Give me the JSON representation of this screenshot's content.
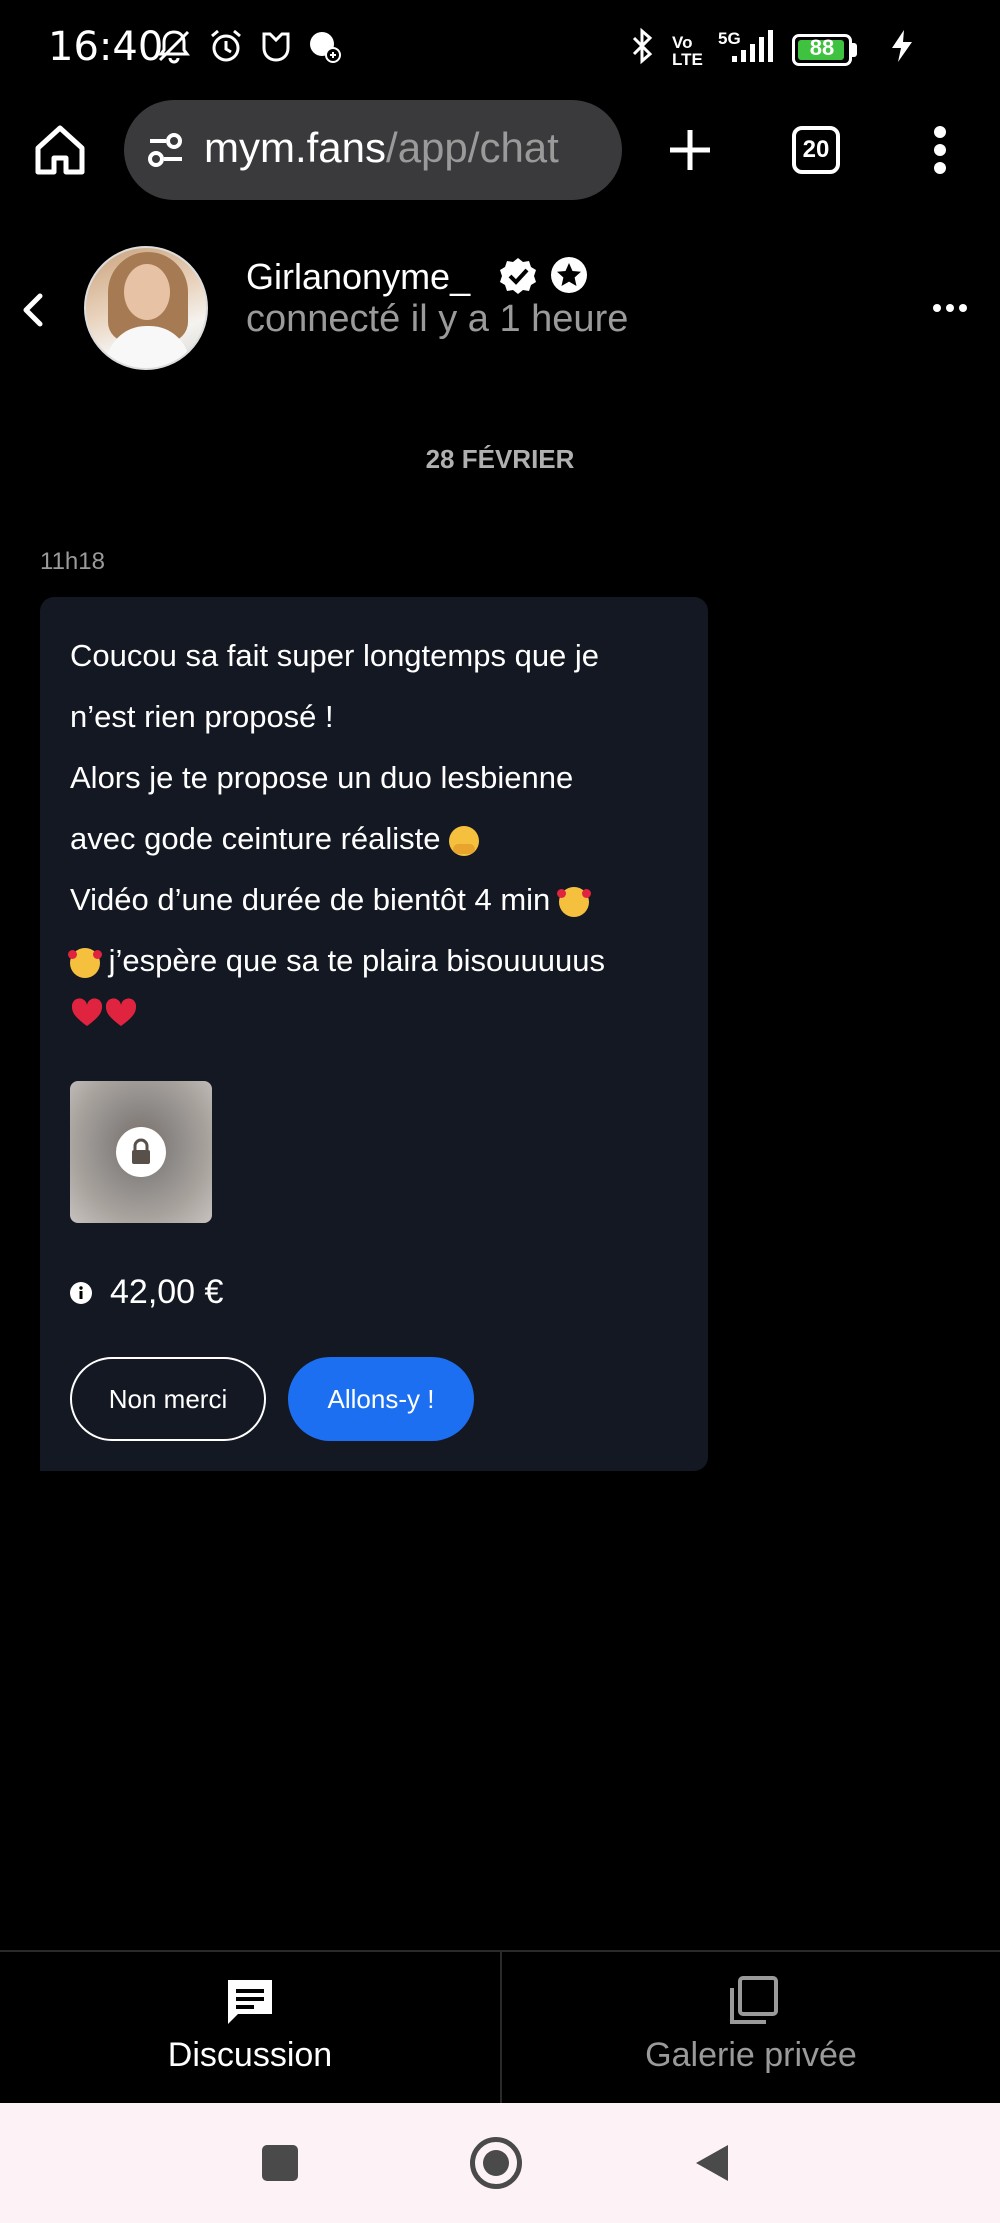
{
  "status_bar": {
    "time": "16:40",
    "battery_level": "88",
    "network_volte": "Vo\nLTE",
    "network_5g": "5G",
    "icons": [
      "mute-icon",
      "alarm-icon",
      "app-notification-icon",
      "vpn-icon",
      "bluetooth-icon",
      "volte-icon",
      "signal-icon",
      "battery-icon",
      "charging-icon"
    ],
    "battery_color": "#3fc23f"
  },
  "browser": {
    "url_domain": "mym.fans",
    "url_path": "/app/chat",
    "tab_count": "20"
  },
  "chat_header": {
    "username": "Girlanonyme_",
    "last_seen": "connecté il y a 1 heure"
  },
  "conversation": {
    "date_separator": "28 FÉVRIER",
    "message": {
      "time": "11h18",
      "lines": [
        "Coucou sa fait super longtemps que je",
        "n’est rien proposé !",
        "Alors je te propose un duo lesbienne",
        "avec gode ceinture réaliste",
        "Vidéo d’une durée de bientôt 4 min",
        "j’espère que sa te plaira bisouuuuus"
      ],
      "price": "42,00 €",
      "decline_label": "Non merci",
      "accept_label": "Allons-y !",
      "accent_color": "#1d6ff2"
    }
  },
  "bottom_tabs": {
    "discussion": "Discussion",
    "gallery": "Galerie privée"
  }
}
